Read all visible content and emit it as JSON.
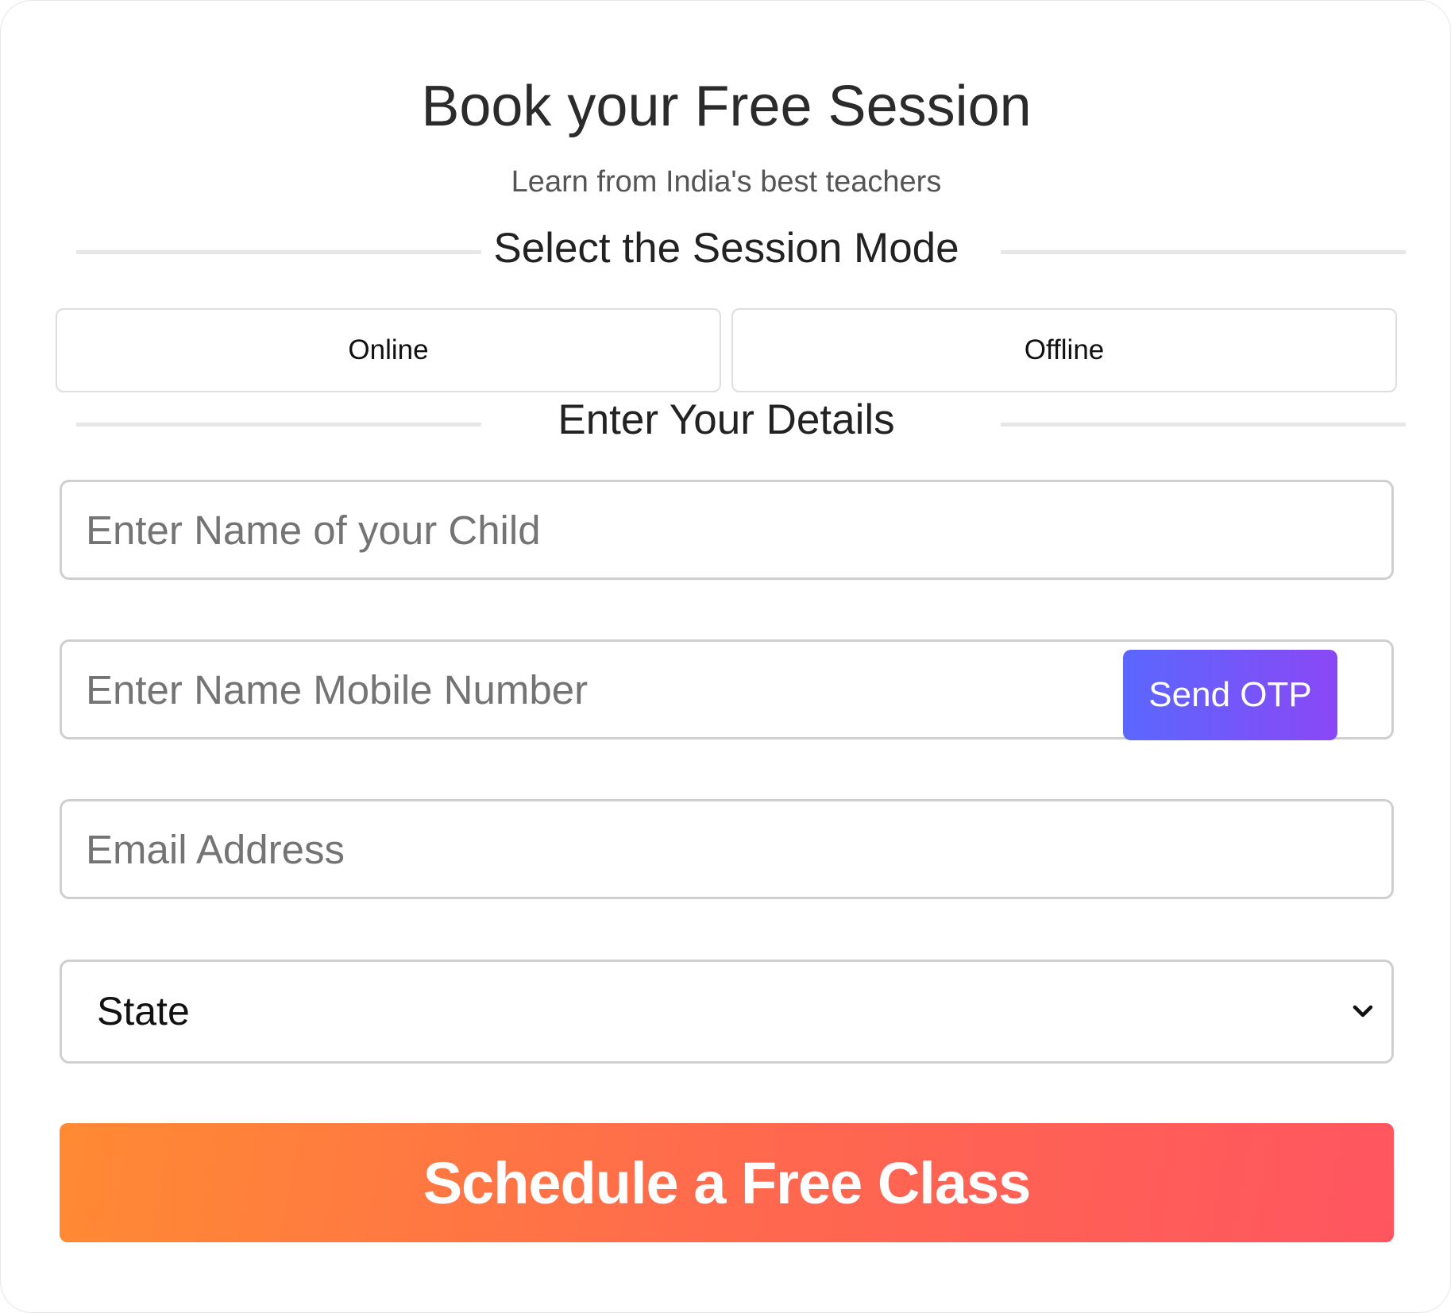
{
  "header": {
    "title": "Book your Free Session",
    "subtitle": "Learn from India's best teachers"
  },
  "session_mode": {
    "heading": "Select the Session Mode",
    "options": [
      {
        "label": "Online"
      },
      {
        "label": "Offline"
      }
    ]
  },
  "details": {
    "heading": "Enter Your Details",
    "child_name": {
      "placeholder": "Enter Name of your Child",
      "value": ""
    },
    "mobile": {
      "placeholder": "Enter Name Mobile Number",
      "value": ""
    },
    "send_otp_label": "Send OTP",
    "email": {
      "placeholder": "Email Address",
      "value": ""
    },
    "state": {
      "selected": "State"
    }
  },
  "cta": {
    "label": "Schedule a Free Class"
  },
  "colors": {
    "otp_gradient": [
      "#5b67ff",
      "#8a48f5"
    ],
    "cta_gradient": [
      "#ff8a33",
      "#ff5560"
    ]
  }
}
